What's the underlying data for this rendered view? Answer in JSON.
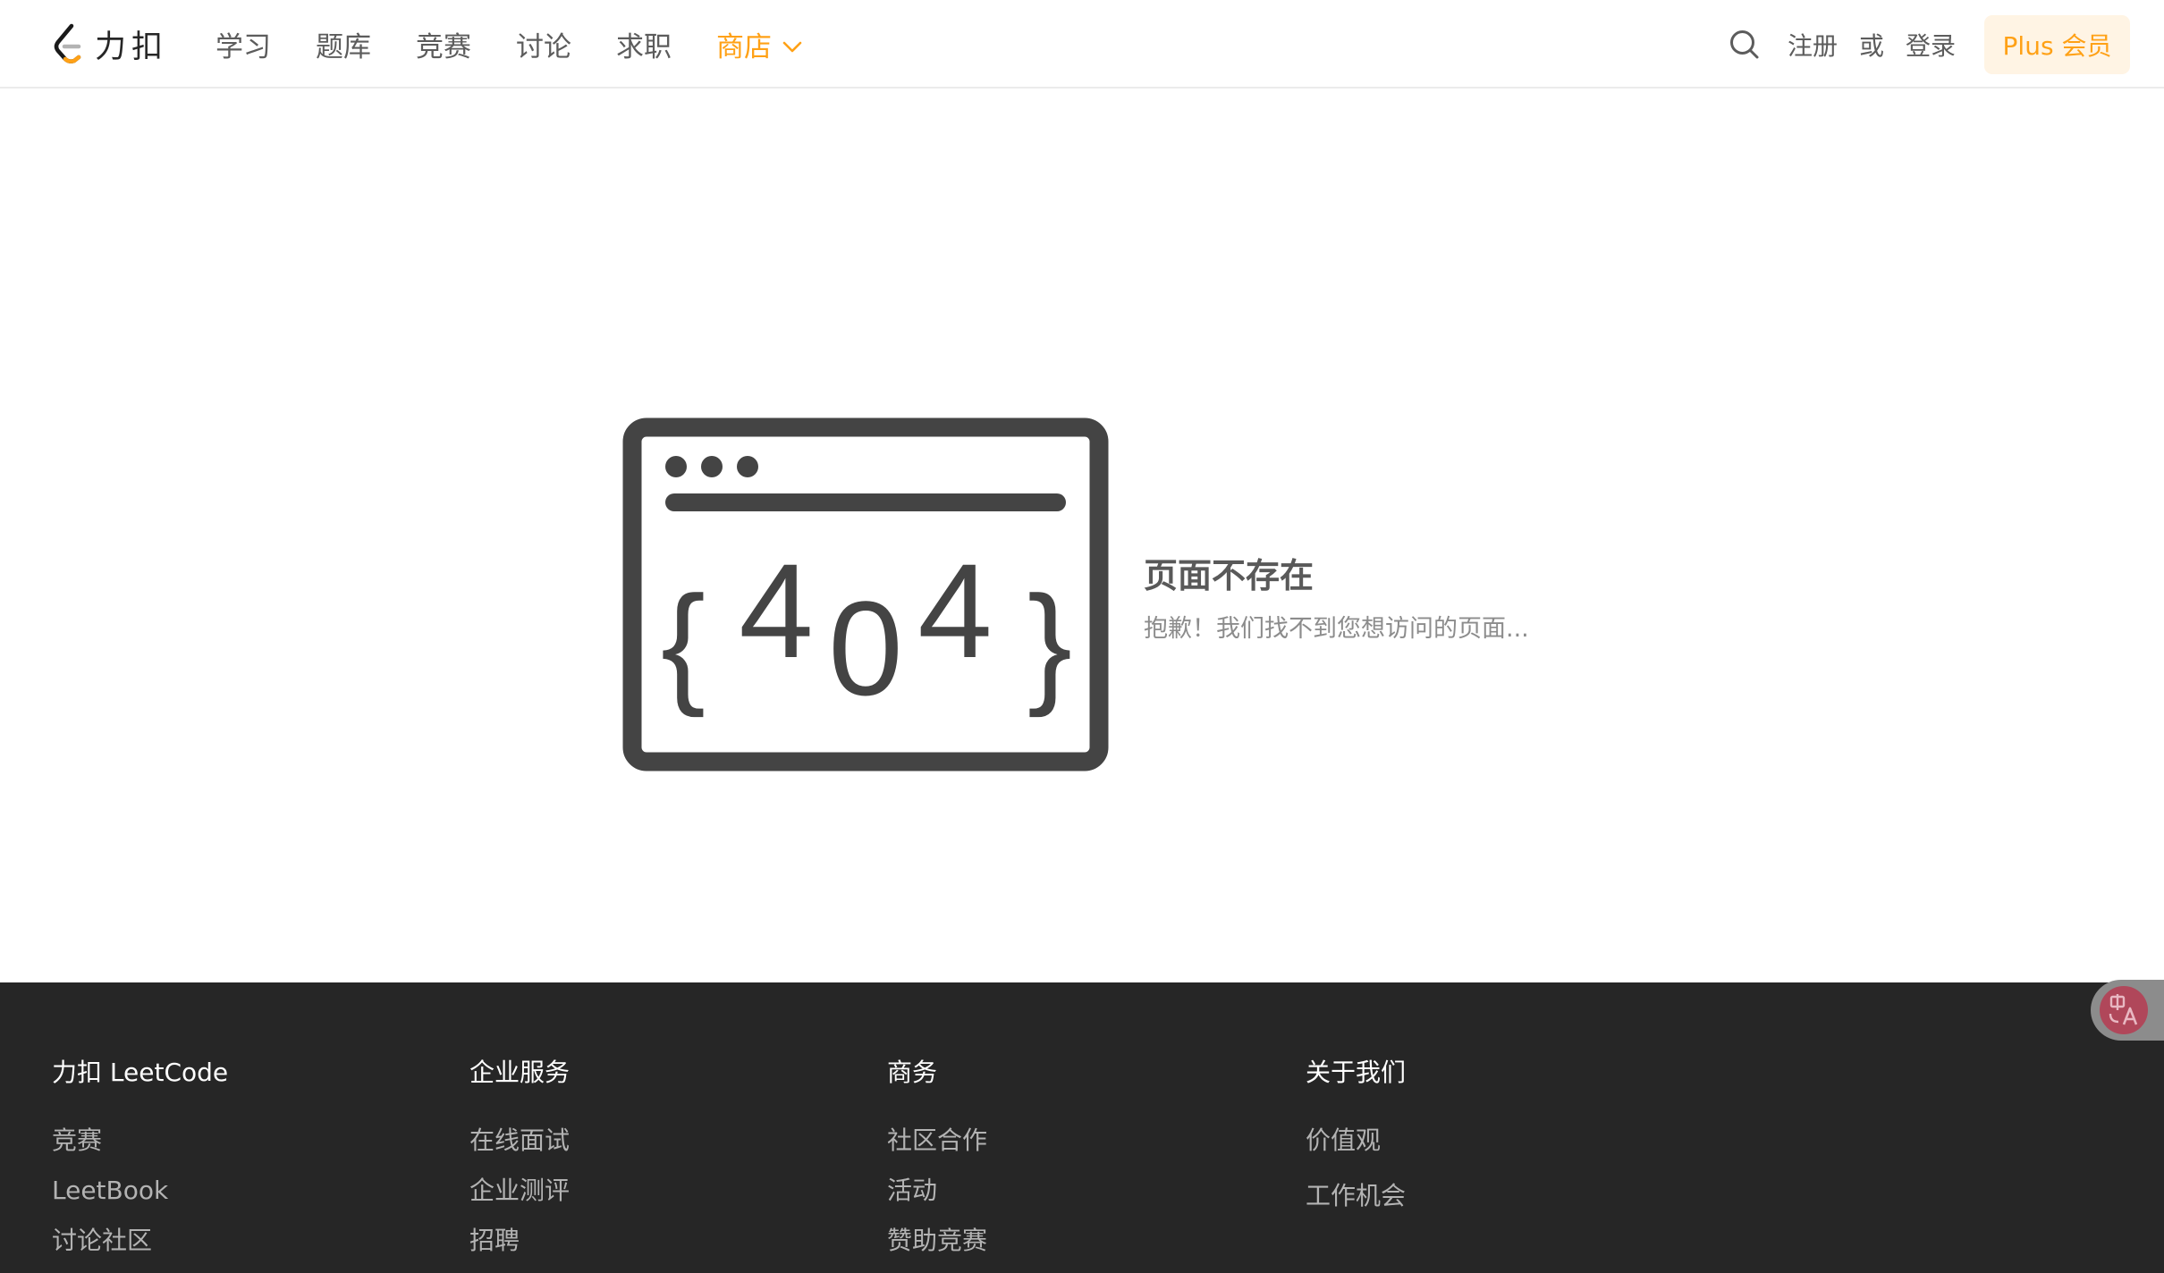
{
  "header": {
    "logo_text": "力扣",
    "nav": [
      {
        "label": "学习"
      },
      {
        "label": "题库"
      },
      {
        "label": "竞赛"
      },
      {
        "label": "讨论"
      },
      {
        "label": "求职"
      },
      {
        "label": "商店",
        "active": true
      }
    ],
    "register_label": "注册",
    "or_label": "或",
    "login_label": "登录",
    "plus_label": "Plus 会员"
  },
  "error": {
    "graphic_text": [
      "{",
      "4",
      "0",
      "4",
      "}"
    ],
    "title": "页面不存在",
    "subtitle": "抱歉！我们找不到您想访问的页面..."
  },
  "footer": {
    "columns": [
      {
        "heading": "力扣 LeetCode",
        "links": [
          "竞赛",
          "LeetBook",
          "讨论社区"
        ]
      },
      {
        "heading": "企业服务",
        "links": [
          "在线面试",
          "企业测评",
          "招聘"
        ]
      },
      {
        "heading": "商务",
        "links": [
          "社区合作",
          "活动",
          "赞助竞赛"
        ]
      },
      {
        "heading": "关于我们",
        "links": [
          "价值观",
          "工作机会"
        ]
      }
    ]
  },
  "colors": {
    "accent": "#ffa116",
    "footer_bg": "#262626",
    "illustration": "#444444"
  },
  "icons": {
    "search": "search-icon",
    "chevron": "chevron-down-icon",
    "translate": "translate-icon"
  }
}
